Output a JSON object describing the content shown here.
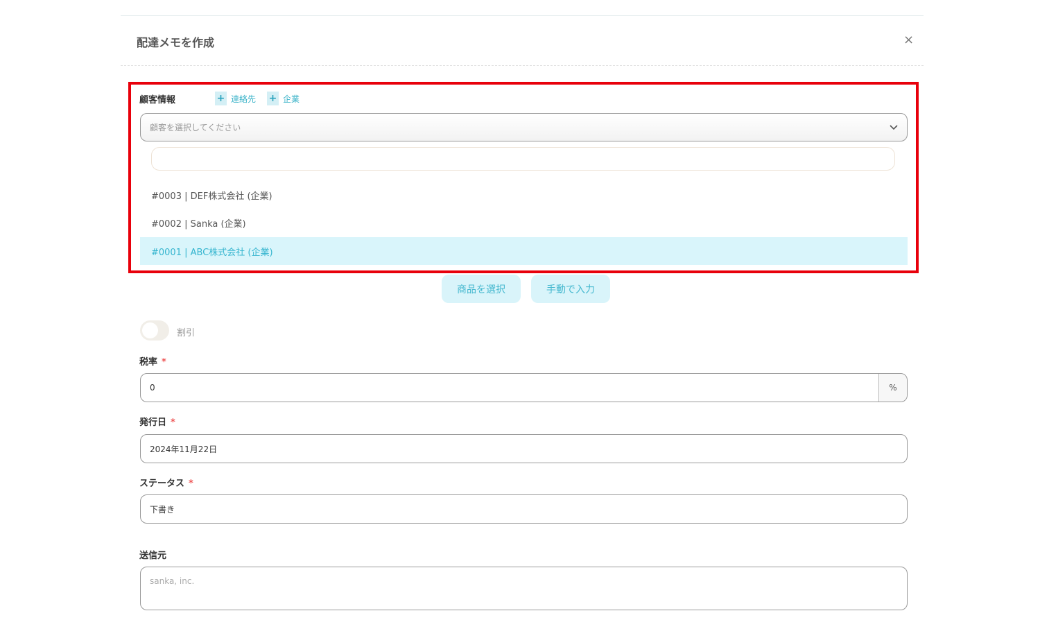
{
  "modal": {
    "title": "配達メモを作成",
    "close": "×"
  },
  "customer": {
    "label": "顧客情報",
    "add_contact": "連絡先",
    "add_company": "企業",
    "plus": "+",
    "placeholder": "顧客を選択してください",
    "search_value": "",
    "options": [
      "#0003 | DEF株式会社 (企業)",
      "#0002 | Sanka (企業)",
      "#0001 | ABC株式会社 (企業)"
    ],
    "highlighted_index": 2
  },
  "items": {
    "select_product": "商品を選択",
    "manual_entry": "手動で入力"
  },
  "discount": {
    "label": "割引",
    "enabled": false
  },
  "tax": {
    "label": "税率",
    "required": "*",
    "value": "0",
    "unit": "%"
  },
  "issue_date": {
    "label": "発行日",
    "required": "*",
    "value": "2024年11月22日"
  },
  "status": {
    "label": "ステータス",
    "required": "*",
    "value": "下書き"
  },
  "sender": {
    "label": "送信元",
    "placeholder": "sanka, inc."
  }
}
